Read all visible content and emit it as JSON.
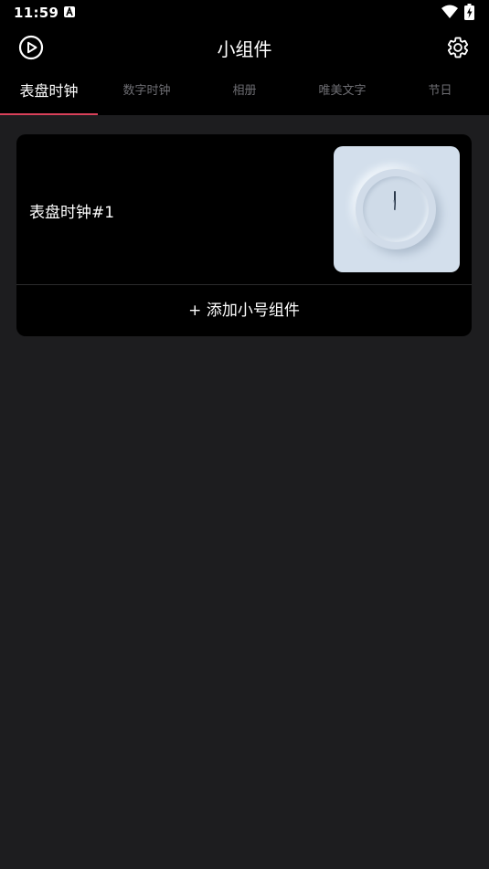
{
  "status_bar": {
    "time": "11:59"
  },
  "app_bar": {
    "title": "小组件",
    "left_icon": "play-circle-icon",
    "right_icon": "gear-icon"
  },
  "tabs": [
    {
      "label": "表盘时钟",
      "active": true
    },
    {
      "label": "数字时钟",
      "active": false
    },
    {
      "label": "相册",
      "active": false
    },
    {
      "label": "唯美文字",
      "active": false
    },
    {
      "label": "节日",
      "active": false
    }
  ],
  "widget_card": {
    "items": [
      {
        "name": "表盘时钟#1",
        "preview": "analog-clock-preview"
      }
    ],
    "add_label": "+ 添加小号组件"
  },
  "colors": {
    "background": "#1d1d1f",
    "bar": "#000000",
    "accent": "#d9415a",
    "inactive_tab": "#6e6e73",
    "preview_bg": "#d3dfec"
  }
}
